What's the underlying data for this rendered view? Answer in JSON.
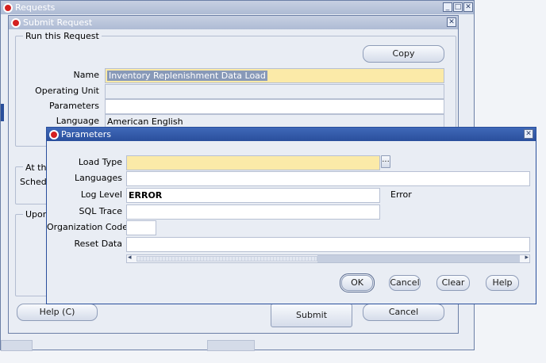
{
  "requests_window": {
    "title": "Requests",
    "controls": [
      "_",
      "□",
      "✕"
    ]
  },
  "submit_window": {
    "title": "Submit Request",
    "section_run": "Run this Request",
    "copy_button": "Copy",
    "name_label": "Name",
    "name_value": "Inventory Replenishment Data Load",
    "operating_unit_label": "Operating Unit",
    "operating_unit_value": "",
    "parameters_label": "Parameters",
    "parameters_value": "",
    "language_label": "Language",
    "language_value": "American English",
    "section_at_the": "At the",
    "schedule_label": "Schedu",
    "section_upon": "Upon",
    "help_button": "Help (C)",
    "submit_button": "Submit",
    "cancel_button": "Cancel"
  },
  "parameters_window": {
    "title": "Parameters",
    "fields": [
      {
        "label": "Load Type",
        "value": ""
      },
      {
        "label": "Languages",
        "value": ""
      },
      {
        "label": "Log Level",
        "value": "ERROR",
        "description": "Error"
      },
      {
        "label": "SQL Trace",
        "value": ""
      },
      {
        "label": "Organization Code",
        "value": ""
      },
      {
        "label": "Reset Data",
        "value": ""
      }
    ],
    "lov_button": "...",
    "ok_button": "OK",
    "cancel_button": "Cancel",
    "clear_button": "Clear",
    "help_button": "Help"
  },
  "colors": {
    "active_title": "#2a4f9c",
    "inactive_title": "#aebbd4",
    "required_field": "#fbeaa8",
    "window_bg": "#e9edf4"
  }
}
